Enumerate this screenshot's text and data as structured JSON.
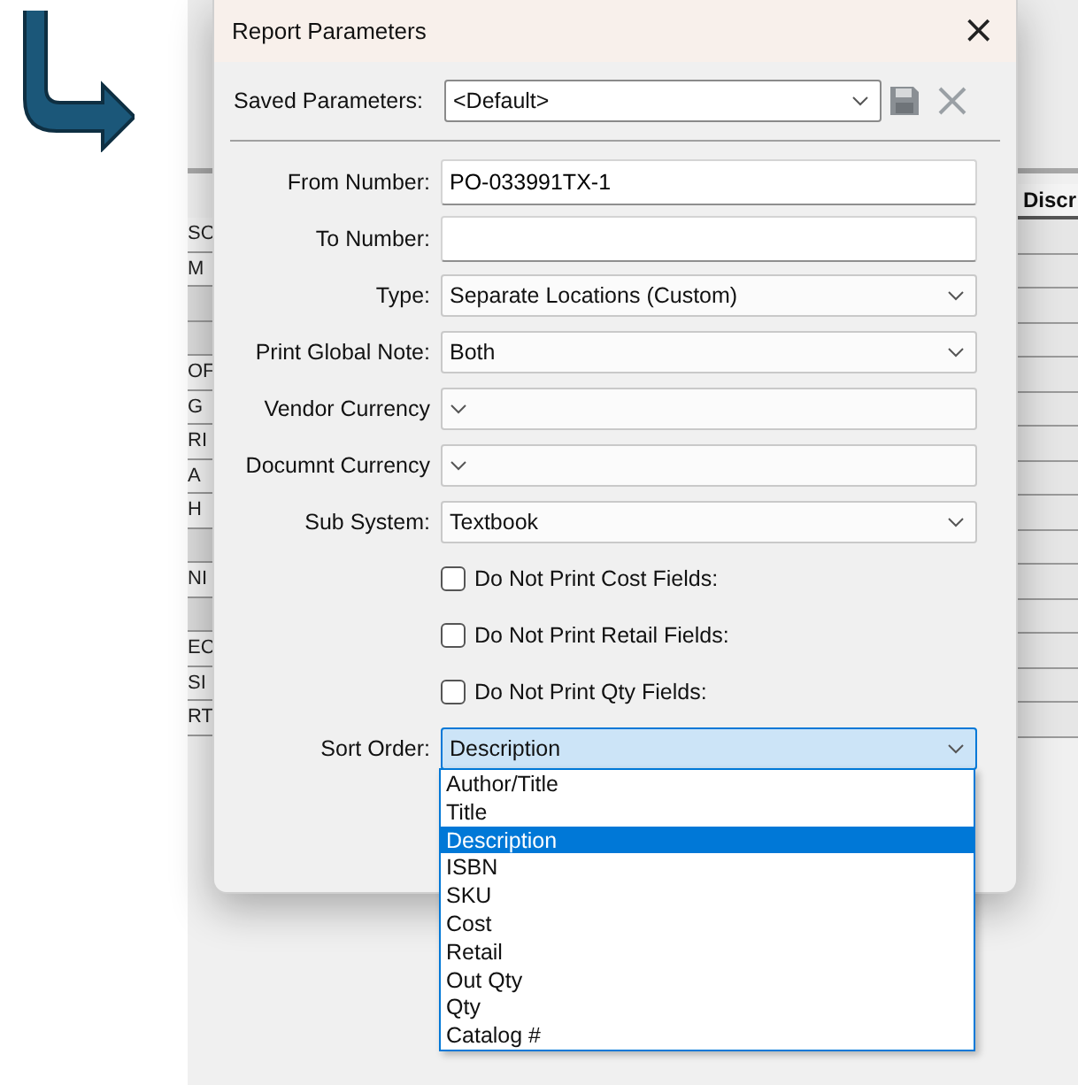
{
  "background_table": {
    "left_cells": [
      {
        "kind": "text",
        "text": "SO"
      },
      {
        "kind": "text",
        "text": "M"
      },
      {
        "kind": "blank"
      },
      {
        "kind": "blank"
      },
      {
        "kind": "text",
        "text": "OF"
      },
      {
        "kind": "text",
        "text": "G"
      },
      {
        "kind": "text",
        "text": "RI"
      },
      {
        "kind": "text",
        "text": "A"
      },
      {
        "kind": "text",
        "text": "H"
      },
      {
        "kind": "blank"
      },
      {
        "kind": "text",
        "text": "NI"
      },
      {
        "kind": "blank"
      },
      {
        "kind": "text",
        "text": "EC"
      },
      {
        "kind": "text",
        "text": "SI"
      },
      {
        "kind": "text",
        "text": "RT"
      }
    ],
    "right_header": "Discr"
  },
  "dialog": {
    "title": "Report Parameters",
    "close": "×",
    "saved_parameters": {
      "label": "Saved Parameters:",
      "value": "<Default>"
    },
    "fields": [
      {
        "label": "From Number:",
        "kind": "text",
        "value": "PO-033991TX-1"
      },
      {
        "label": "To Number:",
        "kind": "text"
      },
      {
        "label": "Type:",
        "kind": "dropdown",
        "value": "Separate Locations (Custom)"
      },
      {
        "label": "Print Global Note:",
        "kind": "dropdown",
        "value": "Both"
      },
      {
        "label": "Vendor Currency",
        "kind": "dropdown"
      },
      {
        "label": "Documnt Currency",
        "kind": "dropdown"
      },
      {
        "label": "Sub System:",
        "kind": "dropdown",
        "value": "Textbook"
      }
    ],
    "checkboxes": [
      {
        "label": "Do Not Print Cost Fields:",
        "checked": false
      },
      {
        "label": "Do Not Print Retail Fields:",
        "checked": false
      },
      {
        "label": "Do Not Print Qty Fields:",
        "checked": false
      }
    ],
    "sort_order": {
      "label": "Sort Order:",
      "value": "Description",
      "expanded": true,
      "options": [
        {
          "label": "Author/Title",
          "selected": false
        },
        {
          "label": "Title",
          "selected": false
        },
        {
          "label": "Description",
          "selected": true
        },
        {
          "label": "ISBN",
          "selected": false
        },
        {
          "label": "SKU",
          "selected": false
        },
        {
          "label": "Cost",
          "selected": false
        },
        {
          "label": "Retail",
          "selected": false
        },
        {
          "label": "Out Qty",
          "selected": false
        },
        {
          "label": "Qty",
          "selected": false
        },
        {
          "label": "Catalog #",
          "selected": false
        }
      ]
    }
  }
}
